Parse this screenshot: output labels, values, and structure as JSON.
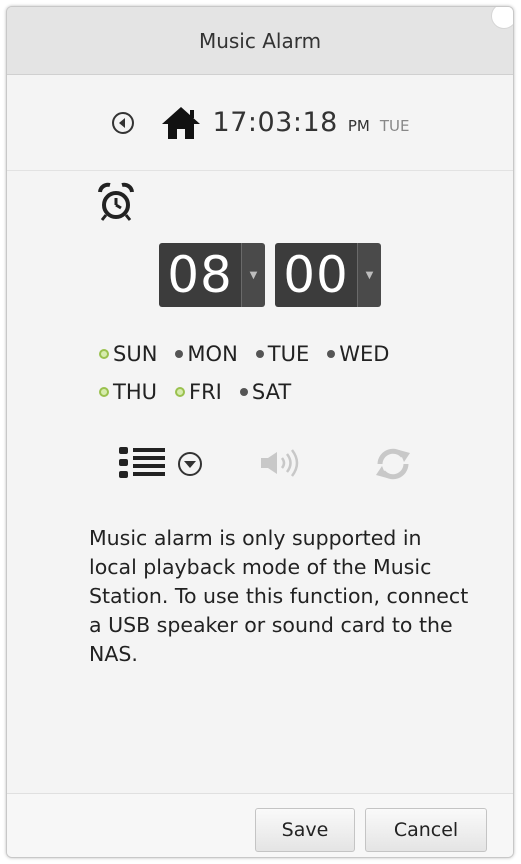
{
  "dialog": {
    "title": "Music Alarm"
  },
  "clock": {
    "time": "17:03:18",
    "ampm": "PM",
    "day": "TUE"
  },
  "alarm": {
    "hour": "08",
    "minute": "00"
  },
  "days": [
    {
      "label": "SUN",
      "checked": true
    },
    {
      "label": "MON",
      "checked": false
    },
    {
      "label": "TUE",
      "checked": false
    },
    {
      "label": "WED",
      "checked": false
    },
    {
      "label": "THU",
      "checked": true
    },
    {
      "label": "FRI",
      "checked": true
    },
    {
      "label": "SAT",
      "checked": false
    }
  ],
  "notice": "Music alarm is only supported in local playback mode of the Music Station. To use this function, connect a USB speaker or sound card to the NAS.",
  "buttons": {
    "save": "Save",
    "cancel": "Cancel"
  },
  "icons": {
    "back": "back-circle-icon",
    "home": "home-icon",
    "alarm": "alarm-clock-icon",
    "playlist": "playlist-icon",
    "dropdown": "chevron-down-circle-icon",
    "volume": "volume-icon",
    "repeat": "repeat-icon"
  },
  "colors": {
    "day_checked": "#9ac14e",
    "picker_bg": "#3c3c3c",
    "disabled_icon": "#c8c8c8"
  }
}
